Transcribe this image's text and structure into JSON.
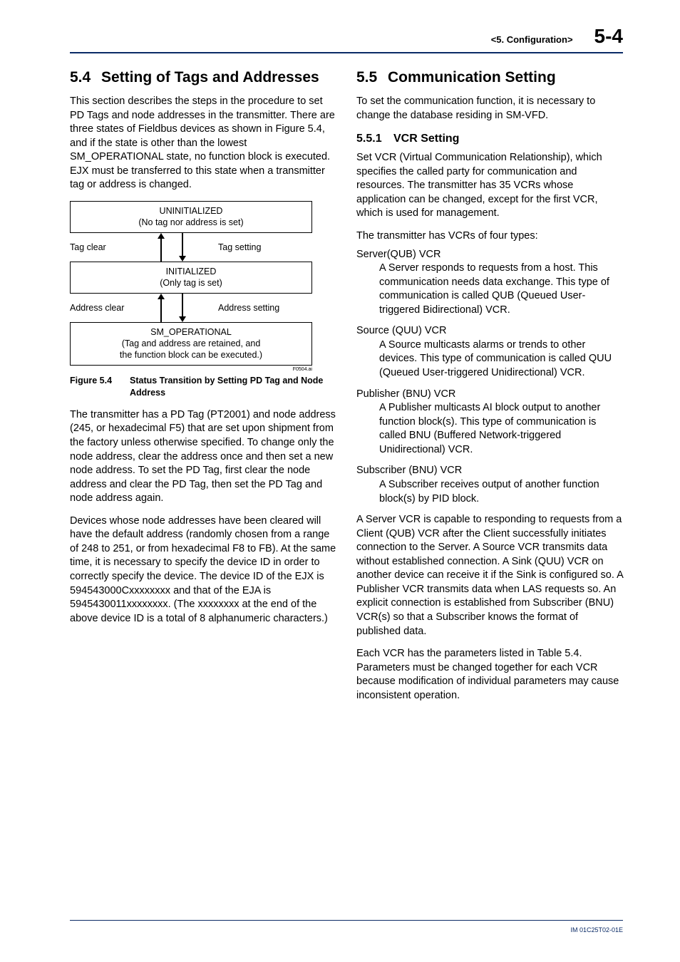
{
  "header": {
    "chapter": "<5.  Configuration>",
    "page": "5-4"
  },
  "left": {
    "h2_num": "5.4",
    "h2_title": "Setting of Tags and Addresses",
    "p1": "This section describes the steps in the procedure to set PD Tags and node addresses in the transmitter. There are three states of Fieldbus devices as shown in Figure 5.4, and if the state is other than the lowest SM_OPERATIONAL state, no function block is executed. EJX must be transferred to this state when a transmitter tag or address is changed.",
    "diagram": {
      "s1a": "UNINITIALIZED",
      "s1b": "(No tag nor address is set)",
      "t1l": "Tag clear",
      "t1r": "Tag setting",
      "s2a": "INITIALIZED",
      "s2b": "(Only tag is set)",
      "t2l": "Address clear",
      "t2r": "Address setting",
      "s3a": "SM_OPERATIONAL",
      "s3b": "(Tag and address are retained, and",
      "s3c": "the function block can be executed.)",
      "ref": "F0504.ai"
    },
    "fig_label": "Figure 5.4",
    "fig_caption": "Status Transition by Setting PD Tag and Node Address",
    "p2": "The transmitter has a PD Tag (PT2001) and node address (245, or hexadecimal F5) that are set upon shipment from the factory unless otherwise specified. To change only the node address, clear the address once and then set a new node address. To set the PD Tag, first clear the node address and clear the PD Tag, then set the PD Tag and node address again.",
    "p3": "Devices whose node addresses have been cleared will have the default address (randomly chosen from a range of 248 to 251, or from hexadecimal F8 to FB). At the same time, it is necessary to specify the device ID in order to correctly specify the device. The device ID of the EJX is 594543000Cxxxxxxxx and that of the EJA is 5945430011xxxxxxxx. (The xxxxxxxx at the end of the above device ID is a total of 8 alphanumeric characters.)"
  },
  "right": {
    "h2_num": "5.5",
    "h2_title": "Communication Setting",
    "p1": "To set the communication function, it is necessary to change the database residing in SM-VFD.",
    "h3_num": "5.5.1",
    "h3_title": "VCR Setting",
    "p2": "Set VCR (Virtual Communication Relationship), which specifies the called party for communication and resources. The transmitter has 35 VCRs whose application can be changed, except for the first VCR, which is used for management.",
    "p3": "The transmitter has VCRs of four types:",
    "defs": [
      {
        "t": "Server(QUB) VCR",
        "d": "A Server responds to requests from a host. This communication needs data exchange. This type of communication is called QUB (Queued User-triggered Bidirectional) VCR."
      },
      {
        "t": "Source (QUU) VCR",
        "d": "A Source multicasts alarms or trends to other devices. This type of communication is called QUU (Queued User-triggered Unidirectional) VCR."
      },
      {
        "t": "Publisher (BNU) VCR",
        "d": "A Publisher multicasts AI block output to another function block(s). This type of communication is called BNU (Buffered Network-triggered Unidirectional) VCR."
      },
      {
        "t": "Subscriber (BNU) VCR",
        "d": "A Subscriber receives output of another function block(s) by PID block."
      }
    ],
    "p4": "A Server VCR is capable to responding to requests from a Client (QUB) VCR after the Client successfully initiates connection to the Server. A Source VCR transmits data without established connection. A Sink (QUU) VCR on another device can receive it if the Sink is configured so. A Publisher VCR transmits data when LAS requests so. An explicit connection is established from Subscriber (BNU) VCR(s) so that a Subscriber knows the format of published data.",
    "p5": "Each VCR has the parameters listed in Table 5.4. Parameters must be changed together for each VCR because modification of individual parameters may cause inconsistent operation."
  },
  "footer": {
    "doc_id": "IM 01C25T02-01E"
  }
}
